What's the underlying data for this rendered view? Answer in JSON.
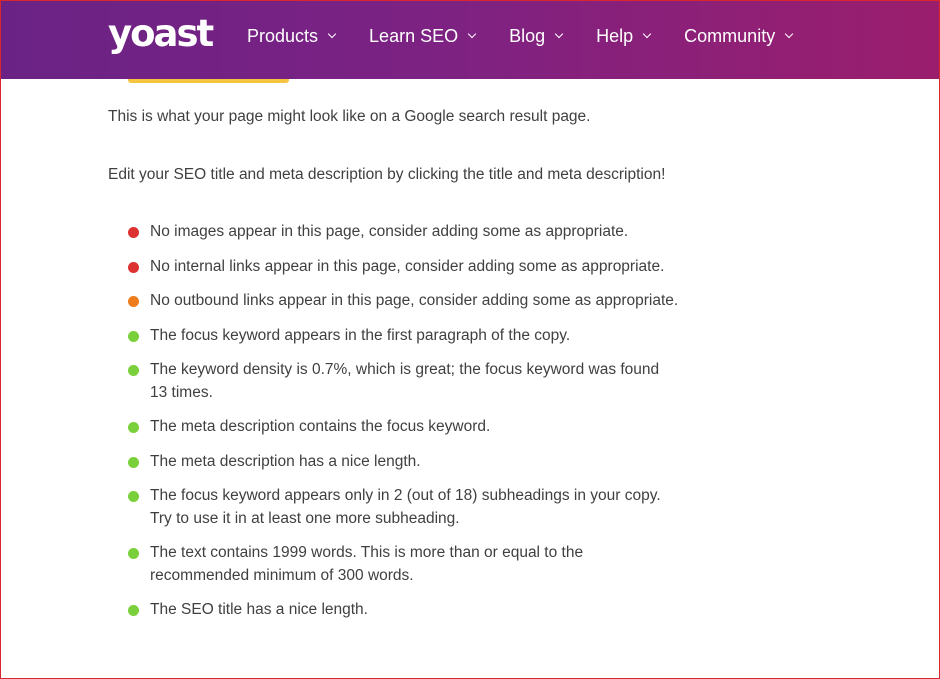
{
  "header": {
    "logo_text": "yoast",
    "nav": [
      {
        "label": "Products"
      },
      {
        "label": "Learn SEO"
      },
      {
        "label": "Blog"
      },
      {
        "label": "Help"
      },
      {
        "label": "Community"
      }
    ]
  },
  "content": {
    "intro": "This is what your page might look like on a Google search result page.",
    "edit_hint": "Edit your SEO title and meta description by clicking the title and meta description!"
  },
  "status_colors": {
    "bad": "#dc3232",
    "ok": "#ee7c1b",
    "good": "#7ad03a"
  },
  "checks": [
    {
      "status": "bad",
      "text": "No images appear in this page, consider adding some as appropriate."
    },
    {
      "status": "bad",
      "text": "No internal links appear in this page, consider adding some as appropriate."
    },
    {
      "status": "ok",
      "text": "No outbound links appear in this page, consider adding some as appropriate."
    },
    {
      "status": "good",
      "text": "The focus keyword appears in the first paragraph of the copy."
    },
    {
      "status": "good",
      "text": "The keyword density is 0.7%, which is great; the focus keyword was found 13 times."
    },
    {
      "status": "good",
      "text": "The meta description contains the focus keyword."
    },
    {
      "status": "good",
      "text": "The meta description has a nice length."
    },
    {
      "status": "good",
      "text": "The focus keyword appears only in 2 (out of 18) subheadings in your copy. Try to use it in at least one more subheading."
    },
    {
      "status": "good",
      "text": "The text contains 1999 words. This is more than or equal to the recommended minimum of 300 words."
    },
    {
      "status": "good",
      "text": "The SEO title has a nice length."
    }
  ]
}
